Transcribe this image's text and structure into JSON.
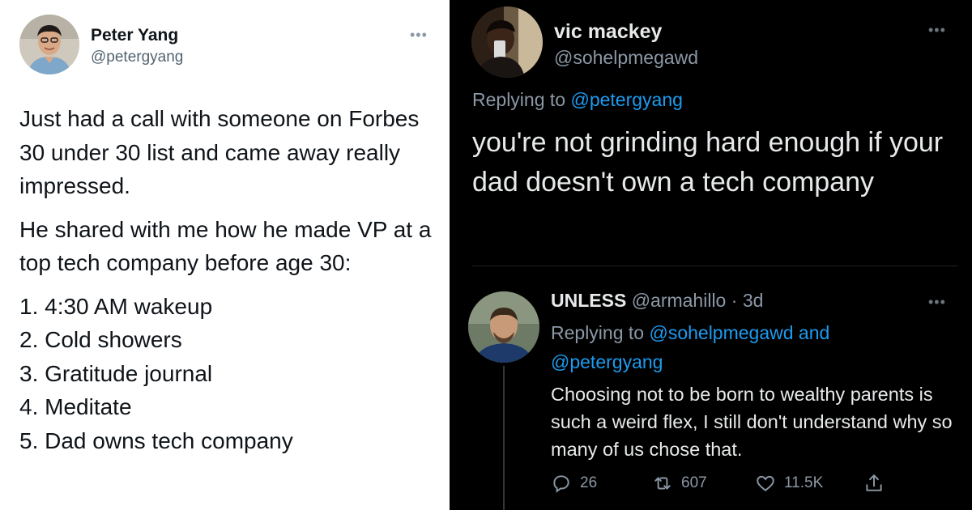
{
  "left_tweet": {
    "author_name": "Peter Yang",
    "author_handle": "@petergyang",
    "more_icon": "more-dots-icon",
    "paragraphs": [
      "Just had a call with someone on Forbes 30 under 30 list and came away really impressed.",
      "He shared with me how he made VP at a top tech company before age 30:"
    ],
    "list_items": [
      "1. 4:30 AM wakeup",
      "2. Cold showers",
      "3. Gratitude journal",
      "4. Meditate",
      "5. Dad owns tech company"
    ]
  },
  "reply_tweet": {
    "author_name": "vic mackey",
    "author_handle": "@sohelpmegawd",
    "replying_prefix": "Replying to",
    "replying_mention": "@petergyang",
    "body": "you're not grinding hard enough if your dad doesn't own a tech company"
  },
  "nested_reply": {
    "author_name": "UNLESS",
    "author_handle": "@armahillo",
    "separator": "·",
    "time": "3d",
    "replying_prefix": "Replying to",
    "replying_mention_1": "@sohelpmegawd",
    "replying_and": "and",
    "replying_mention_2": "@petergyang",
    "body": "Choosing not to be born to wealthy parents is such a weird flex, I still don't understand why so many of us chose that.",
    "actions": {
      "reply_count": "26",
      "retweet_count": "607",
      "like_count": "11.5K"
    }
  },
  "colors": {
    "link_blue": "#1d9bf0",
    "dark_bg": "#000000",
    "light_bg": "#ffffff"
  }
}
